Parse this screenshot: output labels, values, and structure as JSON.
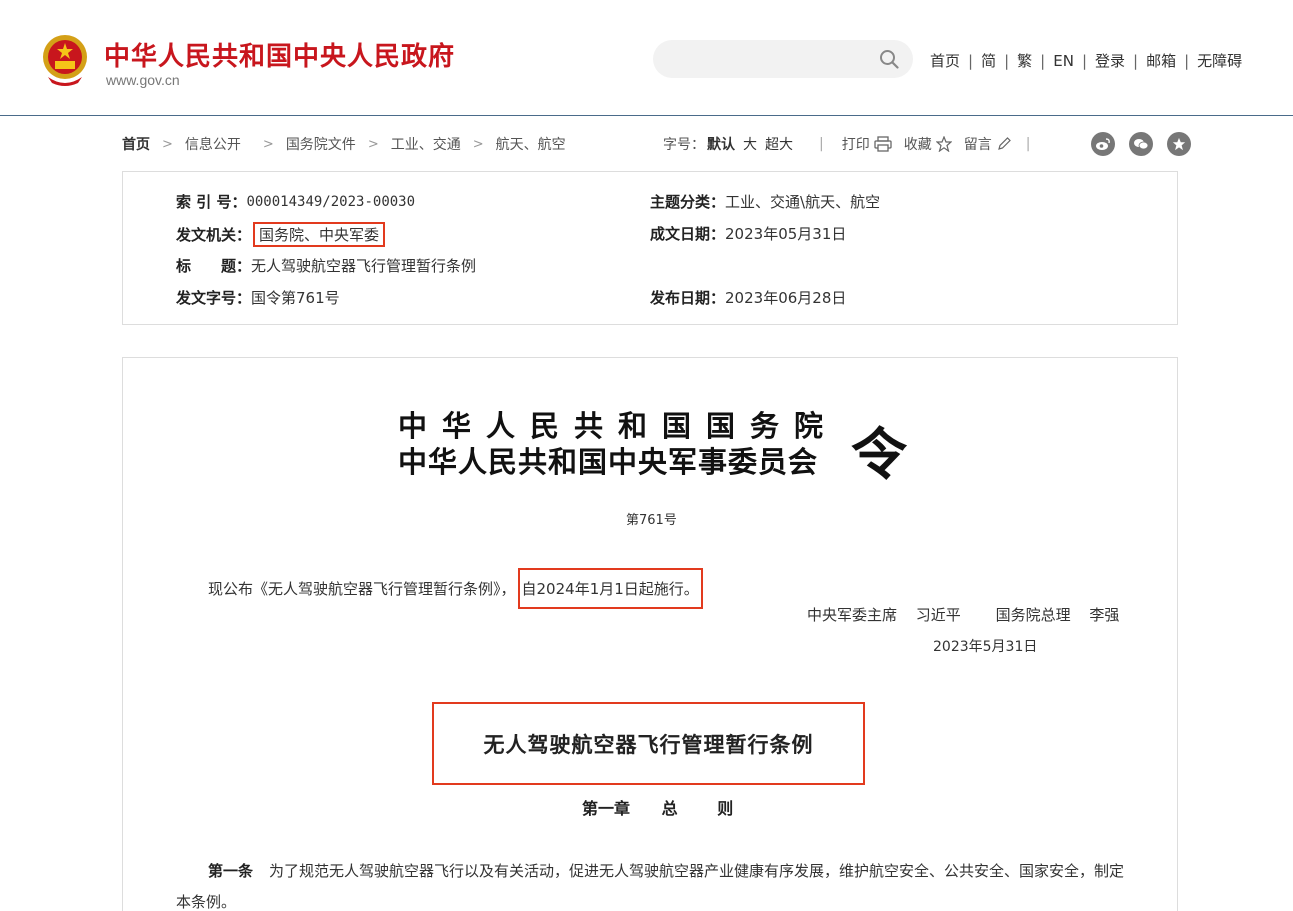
{
  "header": {
    "site_title": "中华人民共和国中央人民政府",
    "site_url": "www.gov.cn",
    "search_placeholder": "",
    "nav": [
      "首页",
      "简",
      "繁",
      "EN",
      "登录",
      "邮箱",
      "无障碍"
    ],
    "brand_color": "#c8161d"
  },
  "breadcrumb": {
    "items": [
      "首页",
      "信息公开",
      "国务院文件",
      "工业、交通",
      "航天、航空"
    ]
  },
  "tools": {
    "font_size_label": "字号：",
    "size_default": "默认",
    "size_large": "大",
    "size_xlarge": "超大",
    "print": "打印",
    "favorite": "收藏",
    "comment": "留言",
    "share_icons": [
      "weibo-icon",
      "wechat-icon",
      "star-icon"
    ]
  },
  "meta": {
    "index_no_label": "索 引 号：",
    "index_no": "000014349/2023-00030",
    "topic_label": "主题分类：",
    "topic": "工业、交通\\航天、航空",
    "issuer_label": "发文机关：",
    "issuer": "国务院、中央军委",
    "written_date_label": "成文日期：",
    "written_date": "2023年05月31日",
    "title_label": "标　　题：",
    "title": "无人驾驶航空器飞行管理暂行条例",
    "doc_no_label": "发文字号：",
    "doc_no": "国令第761号",
    "publish_date_label": "发布日期：",
    "publish_date": "2023年06月28日"
  },
  "document": {
    "header_line1": "中华人民共和国国务院",
    "header_line2": "中华人民共和国中央军事委员会",
    "order_char": "令",
    "order_no": "第761号",
    "promulgate_text": "现公布《无人驾驶航空器飞行管理暂行条例》，",
    "effective_text": "自2024年1月1日起施行。",
    "signer1_title": "中央军委主席",
    "signer1_name": "习近平",
    "signer2_title": "国务院总理",
    "signer2_name": "李强",
    "sign_date": "2023年5月31日",
    "regulation_title": "无人驾驶航空器飞行管理暂行条例",
    "chapter_no": "第一章",
    "chapter_w1": "总",
    "chapter_w2": "则",
    "article1_no": "第一条",
    "article1_text": "为了规范无人驾驶航空器飞行以及有关活动，促进无人驾驶航空器产业健康有序发展，维护航空安全、公共安全、国家安全，制定本条例。"
  },
  "highlight_color": "#e23a1e"
}
